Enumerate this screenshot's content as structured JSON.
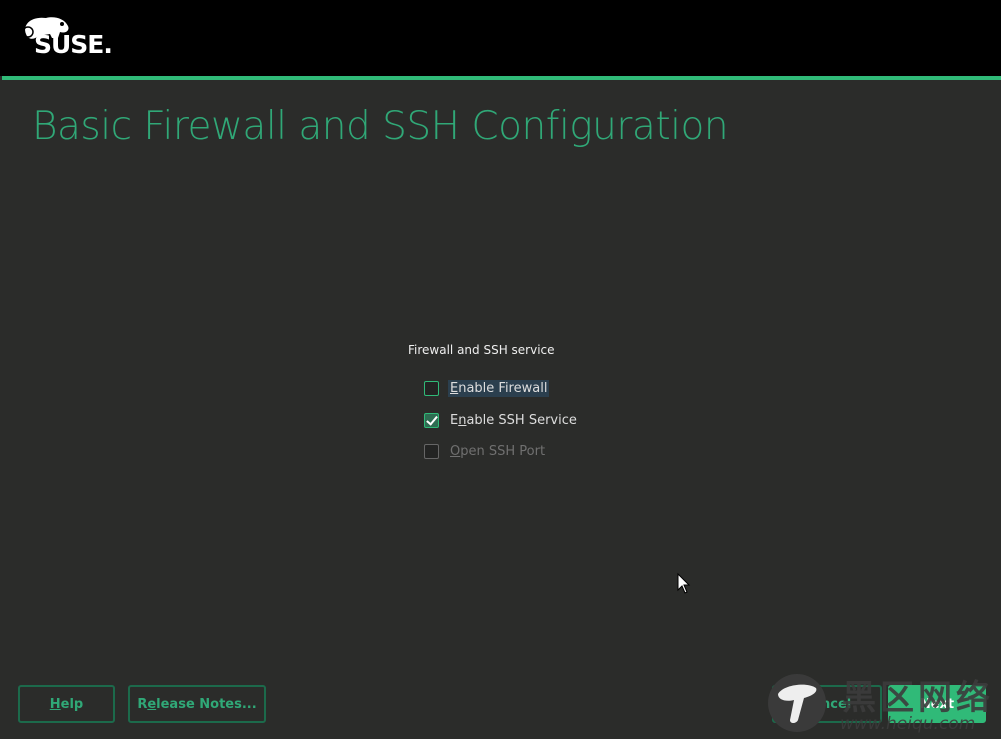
{
  "header": {
    "logo_text": "SUSE.",
    "accent_color": "#30ba78"
  },
  "page_title": "Basic Firewall and SSH Configuration",
  "group": {
    "label": "Firewall and SSH service",
    "options": [
      {
        "mnemonic": "E",
        "rest": "nable Firewall",
        "checked": false,
        "enabled": true,
        "focused": true
      },
      {
        "pre": "E",
        "mnemonic": "n",
        "rest": "able SSH Service",
        "checked": true,
        "enabled": true
      },
      {
        "mnemonic": "O",
        "rest": "pen SSH Port",
        "checked": false,
        "enabled": false
      }
    ]
  },
  "buttons": {
    "help": {
      "mnemonic": "H",
      "rest": "elp"
    },
    "release_notes": {
      "pre": "R",
      "mnemonic": "e",
      "rest": "lease Notes..."
    },
    "cancel": "Cancel",
    "next": "Next"
  },
  "watermark": {
    "text": "黑区网络",
    "url": "www.heiqu.com"
  }
}
